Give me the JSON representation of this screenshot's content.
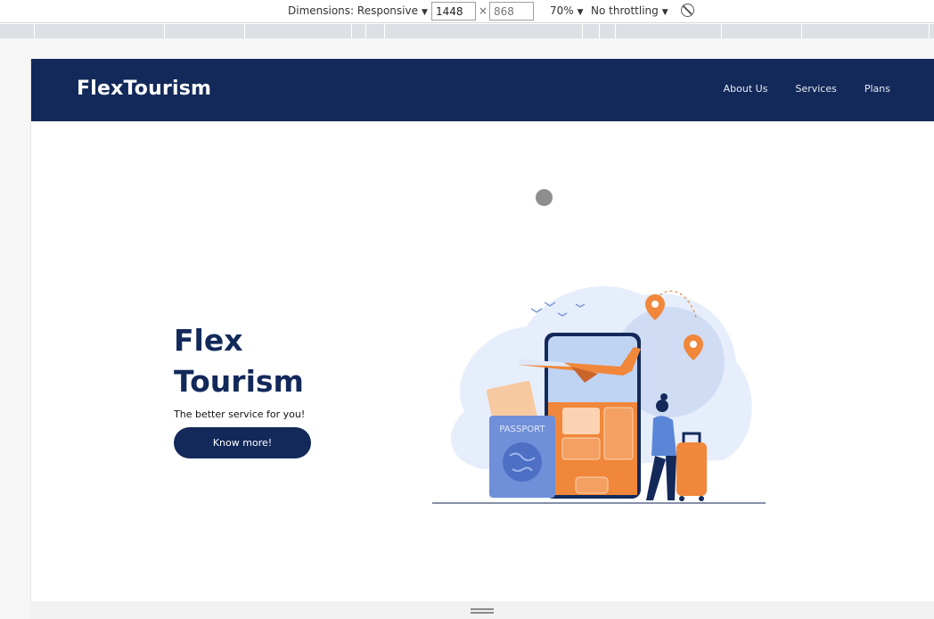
{
  "devtools": {
    "dimensions_label": "Dimensions: Responsive",
    "width_value": "1448",
    "height_placeholder": "868",
    "times": "×",
    "zoom": "70%",
    "throttling": "No throttling",
    "caret": "▼"
  },
  "site": {
    "brand": "FlexTourism",
    "nav": [
      "About Us",
      "Services",
      "Plans"
    ],
    "hero": {
      "title_line1": "Flex",
      "title_line2": "Tourism",
      "subtitle": "The better service for you!",
      "cta": "Know more!"
    },
    "illustration": {
      "passport_label": "PASSPORT"
    }
  },
  "colors": {
    "navy": "#13295a",
    "orange": "#f0873a",
    "light_blue": "#dfe9f9"
  },
  "icons": [
    "rotate-icon",
    "location-pin-icon",
    "airplane-icon",
    "globe-icon"
  ]
}
